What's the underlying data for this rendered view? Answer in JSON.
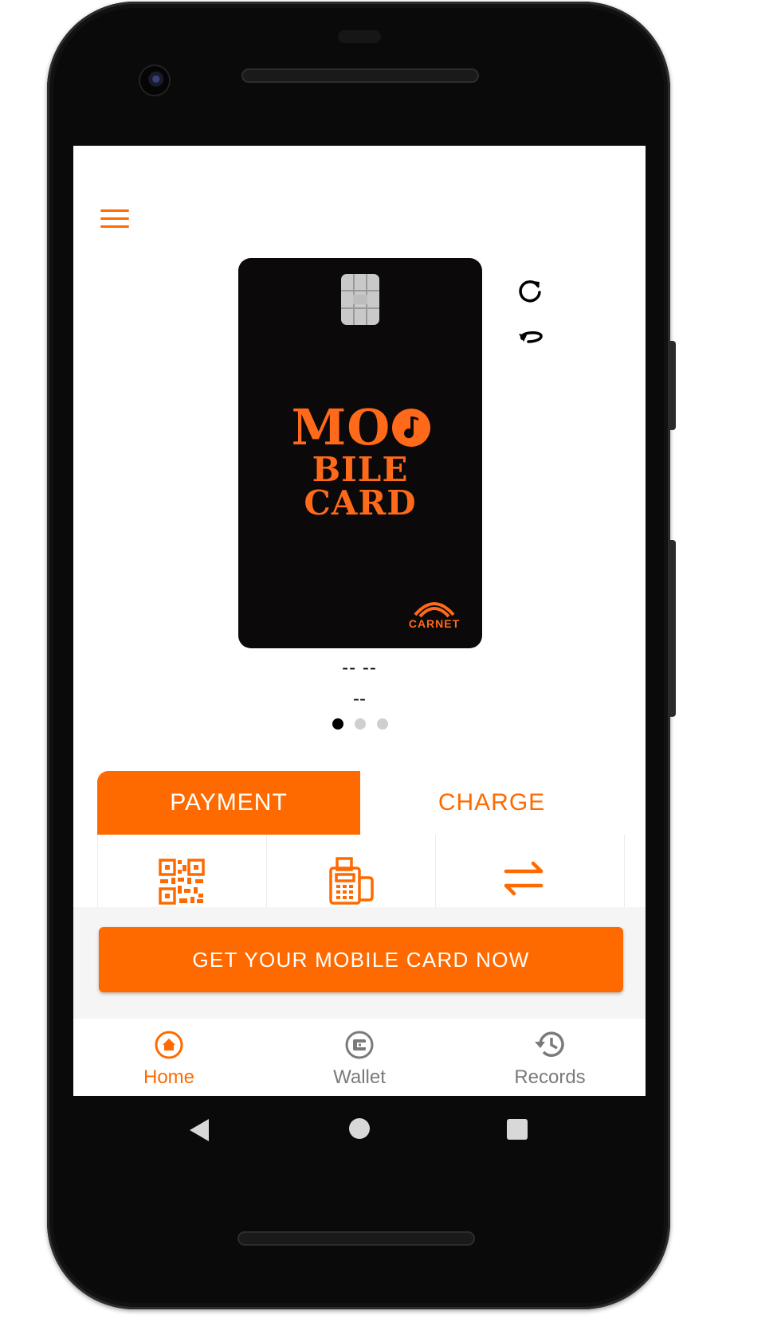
{
  "colors": {
    "accent": "#ff6a00",
    "inactive_nav": "#7a7a7a",
    "card_bg": "#0c090a",
    "cta_bar_bg": "#f5f5f5"
  },
  "header": {
    "menu_icon": "hamburger-menu-icon"
  },
  "card": {
    "logo_lines": [
      "MO",
      "BILE",
      "CARD"
    ],
    "brand": "CARNET",
    "refresh_icon": "refresh-icon",
    "flip_icon": "flip-card-icon"
  },
  "card_info": {
    "name": "-- --",
    "number": "--"
  },
  "carousel": {
    "page_count": 3,
    "active_index": 0
  },
  "tabs": [
    {
      "label": "PAYMENT",
      "active": true
    },
    {
      "label": "CHARGE",
      "active": false
    }
  ],
  "actions": [
    {
      "icon": "qr-code-icon"
    },
    {
      "icon": "pos-terminal-icon"
    },
    {
      "icon": "transfer-arrows-icon"
    }
  ],
  "cta": {
    "label": "GET YOUR MOBILE CARD NOW"
  },
  "bottom_nav": [
    {
      "label": "Home",
      "icon": "home-icon",
      "active": true
    },
    {
      "label": "Wallet",
      "icon": "wallet-icon",
      "active": false
    },
    {
      "label": "Records",
      "icon": "history-icon",
      "active": false
    }
  ],
  "system_nav": [
    "back-icon",
    "home-circle-icon",
    "recents-icon"
  ]
}
